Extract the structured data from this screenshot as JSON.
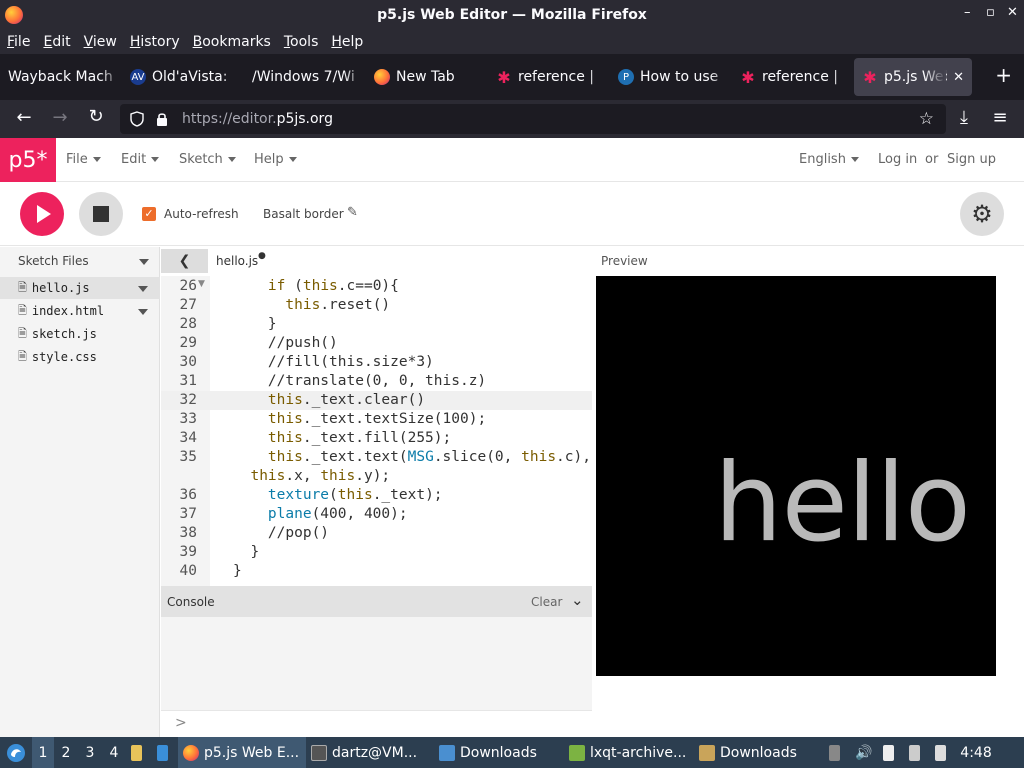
{
  "window": {
    "title": "p5.js Web Editor — Mozilla Firefox",
    "controls": [
      "–",
      "▫",
      "✕"
    ]
  },
  "menubar": [
    "File",
    "Edit",
    "View",
    "History",
    "Bookmarks",
    "Tools",
    "Help"
  ],
  "tabs": [
    {
      "label": "Wayback Mach",
      "icon": "none",
      "color": "#1c1b22"
    },
    {
      "label": "Old'aVista:",
      "icon": "AV",
      "color": "#1a3c8f"
    },
    {
      "label": "/Windows 7/Wi",
      "icon": "none",
      "color": "#1c1b22"
    },
    {
      "label": "New Tab",
      "icon": "firefox",
      "color": "#ff7139"
    },
    {
      "label": "reference |",
      "icon": "p5-star",
      "color": "#ed225d"
    },
    {
      "label": "How to use",
      "icon": "P",
      "color": "#1f6fb2"
    },
    {
      "label": "reference |",
      "icon": "p5-star",
      "color": "#ed225d"
    },
    {
      "label": "p5.js Web",
      "icon": "p5-star",
      "color": "#ed225d",
      "active": true
    }
  ],
  "nav": {
    "url_scheme": "https://editor.",
    "url_host": "p5js.org"
  },
  "p5": {
    "logo": "p5*",
    "menus": [
      "File",
      "Edit",
      "Sketch",
      "Help"
    ],
    "language": "English",
    "login": "Log in",
    "or": "or",
    "signup": "Sign up",
    "auto_refresh": "Auto-refresh",
    "sketch_name": "Basalt border",
    "sidebar_title": "Sketch Files",
    "files": [
      "hello.js",
      "index.html",
      "sketch.js",
      "style.css"
    ],
    "open_file": "hello.js",
    "preview_label": "Preview",
    "console_label": "Console",
    "console_clear": "Clear",
    "console_prompt": ">",
    "preview_text": "hello"
  },
  "code_lines": [
    {
      "n": "26",
      "text": "    if (this.c==0){"
    },
    {
      "n": "27",
      "text": "      this.reset()"
    },
    {
      "n": "28",
      "text": "    }"
    },
    {
      "n": "29",
      "text": "    //push()"
    },
    {
      "n": "30",
      "text": "    //fill(this.size*3)"
    },
    {
      "n": "31",
      "text": "    //translate(0, 0, this.z)"
    },
    {
      "n": "32",
      "text": "    this._text.clear()"
    },
    {
      "n": "33",
      "text": "    this._text.textSize(100);"
    },
    {
      "n": "34",
      "text": "    this._text.fill(255);"
    },
    {
      "n": "35",
      "text": "    this._text.text(MSG.slice(0, this.c),"
    },
    {
      "n": "",
      "text": "  this.x, this.y);"
    },
    {
      "n": "36",
      "text": "    texture(this._text);"
    },
    {
      "n": "37",
      "text": "    plane(400, 400);"
    },
    {
      "n": "38",
      "text": "    //pop()"
    },
    {
      "n": "39",
      "text": "  }"
    },
    {
      "n": "40",
      "text": "}"
    }
  ],
  "taskbar": {
    "workspaces": [
      "1",
      "2",
      "3",
      "4"
    ],
    "items": [
      {
        "label": "p5.js Web E...",
        "active": true
      },
      {
        "label": "dartz@VM..."
      },
      {
        "label": "Downloads"
      },
      {
        "label": "lxqt-archive..."
      },
      {
        "label": "Downloads"
      }
    ],
    "clock": "4:48"
  }
}
